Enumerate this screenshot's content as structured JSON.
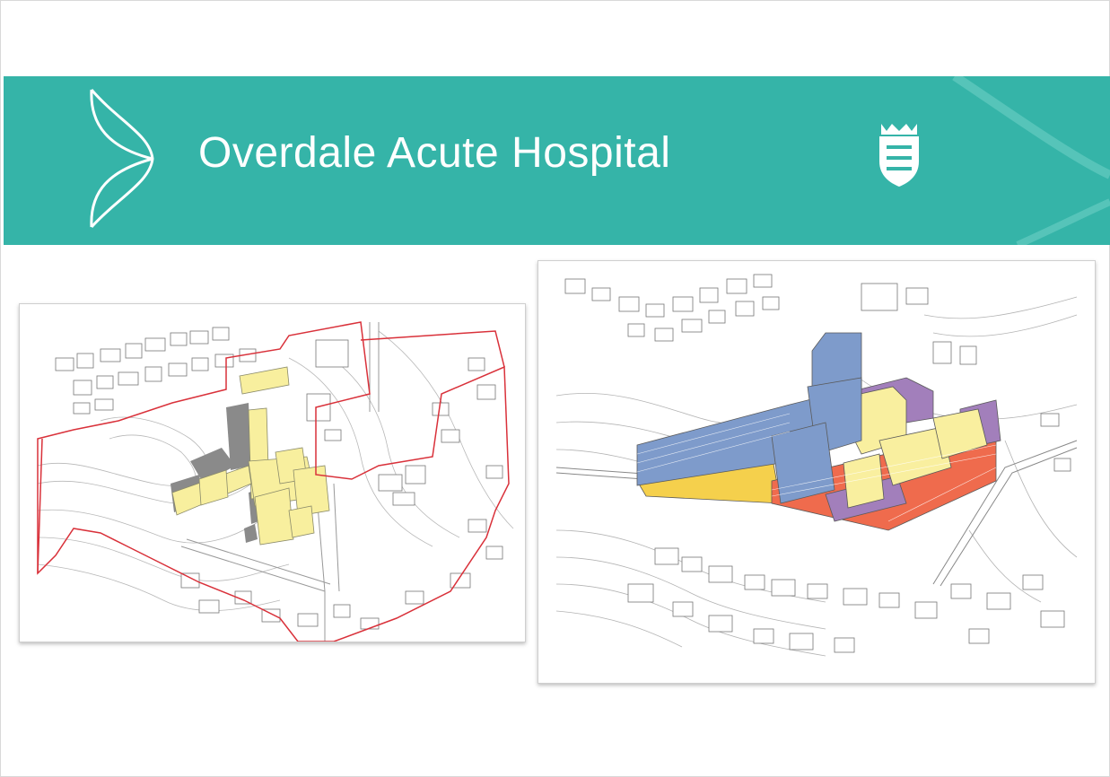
{
  "slide": {
    "title": "Overdale Acute Hospital",
    "colors": {
      "banner": "#35b4a8",
      "title_text": "#ffffff"
    },
    "icons": {
      "logo": "chevron-leaf-logo-icon",
      "crest": "jersey-crest-icon"
    }
  },
  "images": {
    "left": {
      "name": "site-plan-map",
      "colors": {
        "building": "#f8ef9e",
        "boundary": "#d9313a"
      }
    },
    "right": {
      "name": "3d-massing-view",
      "colors": {
        "blue": "#7e9bcb",
        "yellow": "#f9ef9f",
        "orange": "#ef6b4d",
        "purple": "#a27fbb",
        "gold": "#f5d04c"
      }
    }
  }
}
